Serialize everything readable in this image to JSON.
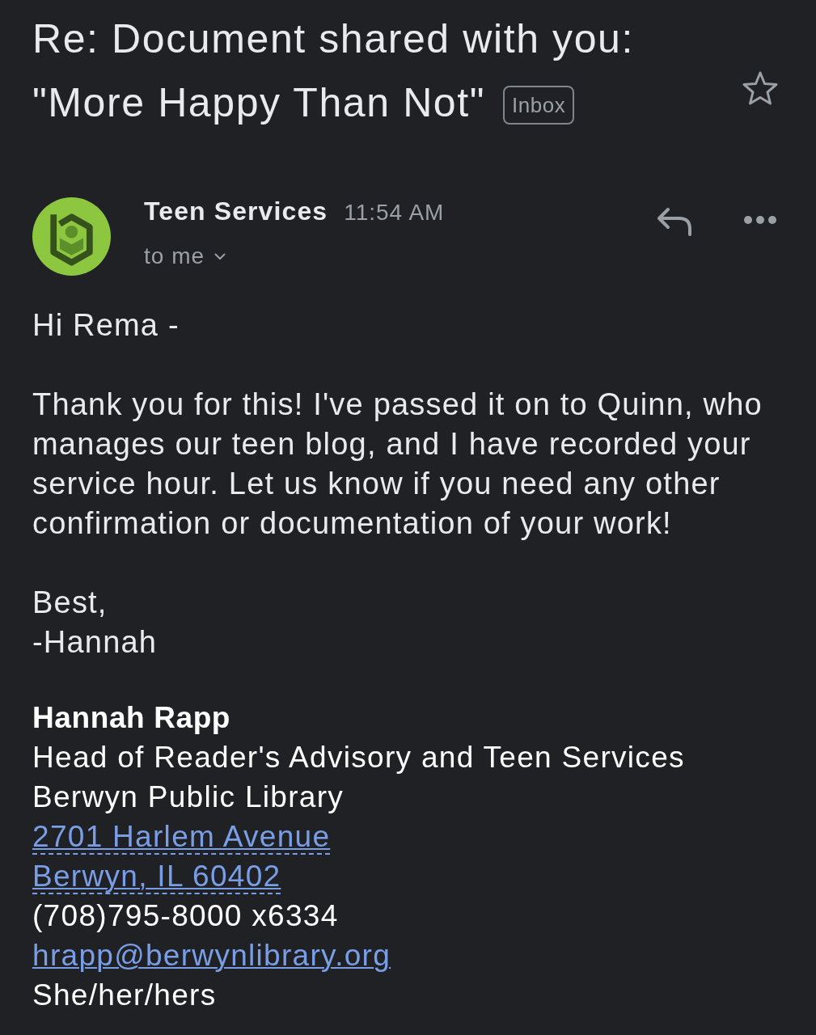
{
  "subject": {
    "title_lines": [
      "Re: Document shared with you:",
      "\"More Happy Than Not\""
    ],
    "label": "Inbox",
    "starred": false
  },
  "message": {
    "sender": "Teen Services",
    "time": "11:54 AM",
    "recipient": "to me"
  },
  "body": {
    "paragraphs": [
      [
        "Hi Rema -"
      ],
      [
        "Thank you for this! I've passed it on to Quinn, who manages our teen blog, and I have recorded your service hour. Let us know if you need any other confirmation or documentation of your work!"
      ],
      [
        "Best,",
        "-Hannah"
      ]
    ]
  },
  "signature": [
    {
      "kind": "name",
      "text": "Hannah Rapp"
    },
    {
      "kind": "text",
      "text": "Head of Reader's Advisory and Teen Services"
    },
    {
      "kind": "text",
      "text": "Berwyn Public Library"
    },
    {
      "kind": "address",
      "text": "2701 Harlem Avenue"
    },
    {
      "kind": "address",
      "text": "Berwyn, IL 60402"
    },
    {
      "kind": "text",
      "text": "(708)795-8000 x6334"
    },
    {
      "kind": "email",
      "text": "hrapp@berwynlibrary.org"
    },
    {
      "kind": "text",
      "text": "She/her/hers"
    }
  ]
}
